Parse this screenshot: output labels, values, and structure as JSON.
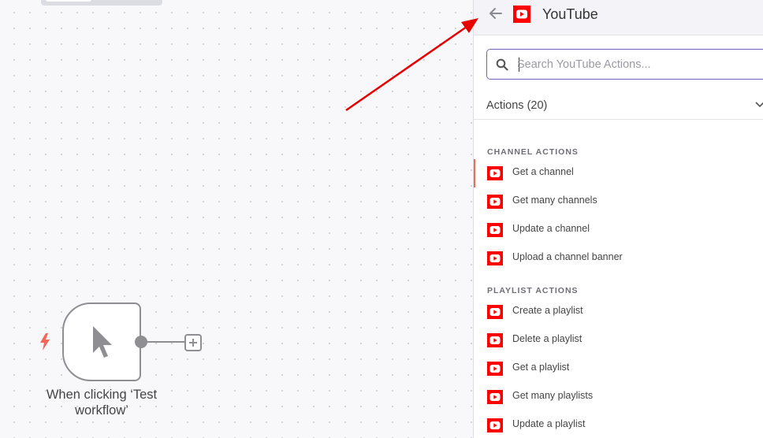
{
  "canvas": {
    "trigger_node": {
      "label": "When clicking ‘Test workflow’",
      "icon": "cursor-pointer-icon",
      "trigger_icon": "lightning-bolt-icon"
    },
    "add_node_icon": "plus-icon"
  },
  "panel": {
    "title": "YouTube",
    "logo_icon": "youtube-icon",
    "back_icon": "arrow-left-icon",
    "search": {
      "placeholder": "Search YouTube Actions...",
      "value": ""
    },
    "actions_header": "Actions (20)",
    "sections": [
      {
        "heading": "CHANNEL ACTIONS",
        "items": [
          {
            "label": "Get a channel"
          },
          {
            "label": "Get many channels"
          },
          {
            "label": "Update a channel"
          },
          {
            "label": "Upload a channel banner"
          }
        ]
      },
      {
        "heading": "PLAYLIST ACTIONS",
        "items": [
          {
            "label": "Create a playlist"
          },
          {
            "label": "Delete a playlist"
          },
          {
            "label": "Get a playlist"
          },
          {
            "label": "Get many playlists"
          },
          {
            "label": "Update a playlist"
          }
        ]
      }
    ]
  },
  "colors": {
    "accent": "#6c63c9",
    "youtube_red": "#ff0000",
    "active_indicator": "#f06a5a",
    "annotation_arrow": "#e60000"
  }
}
